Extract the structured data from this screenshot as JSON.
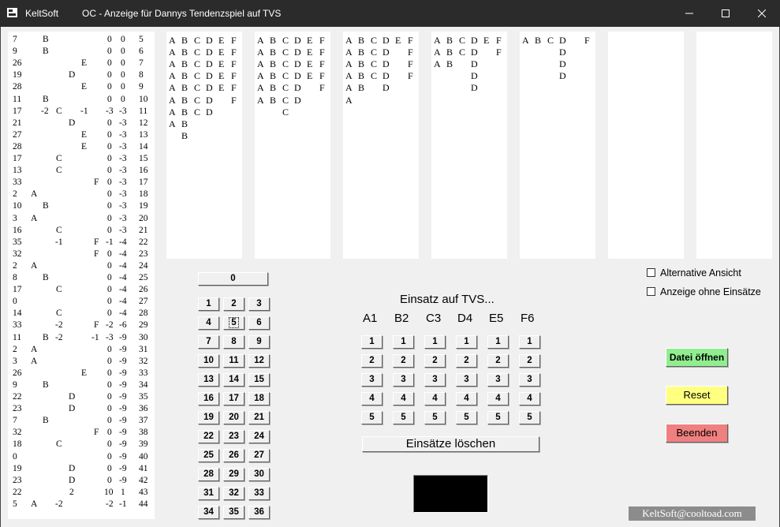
{
  "window": {
    "app_name": "KeltSoft",
    "title": "OC - Anzeige für Dannys Tendenzspiel auf TVS",
    "controls": [
      "minimize-icon",
      "maximize-icon",
      "close-icon"
    ]
  },
  "left_list": [
    [
      "7",
      "",
      "B",
      "",
      "",
      "",
      "",
      "",
      "",
      "0",
      "0",
      "5"
    ],
    [
      "9",
      "",
      "B",
      "",
      "",
      "",
      "",
      "",
      "",
      "0",
      "0",
      "6"
    ],
    [
      "26",
      "",
      "",
      "",
      "",
      "",
      "E",
      "",
      "",
      "0",
      "0",
      "7"
    ],
    [
      "19",
      "",
      "",
      "",
      "",
      "D",
      "",
      "",
      "",
      "0",
      "0",
      "8"
    ],
    [
      "28",
      "",
      "",
      "",
      "",
      "",
      "E",
      "",
      "",
      "0",
      "0",
      "9"
    ],
    [
      "11",
      "",
      "B",
      "",
      "",
      "",
      "",
      "",
      "",
      "0",
      "0",
      "10"
    ],
    [
      "17",
      "",
      "-2",
      "C",
      "-1",
      "",
      "",
      "",
      "",
      "-3",
      "-3",
      "11"
    ],
    [
      "21",
      "",
      "",
      "",
      "",
      "D",
      "",
      "",
      "",
      "0",
      "-3",
      "12"
    ],
    [
      "27",
      "",
      "",
      "",
      "",
      "",
      "E",
      "",
      "",
      "0",
      "-3",
      "13"
    ],
    [
      "28",
      "",
      "",
      "",
      "",
      "",
      "E",
      "",
      "",
      "0",
      "-3",
      "14"
    ],
    [
      "17",
      "",
      "",
      "C",
      "",
      "",
      "",
      "",
      "",
      "0",
      "-3",
      "15"
    ],
    [
      "13",
      "",
      "",
      "C",
      "",
      "",
      "",
      "",
      "",
      "0",
      "-3",
      "16"
    ],
    [
      "33",
      "",
      "",
      "",
      "",
      "",
      "",
      "",
      "F",
      "0",
      "-3",
      "17"
    ],
    [
      "2",
      "A",
      "",
      "",
      "",
      "",
      "",
      "",
      "",
      "0",
      "-3",
      "18"
    ],
    [
      "10",
      "",
      "B",
      "",
      "",
      "",
      "",
      "",
      "",
      "0",
      "-3",
      "19"
    ],
    [
      "3",
      "A",
      "",
      "",
      "",
      "",
      "",
      "",
      "",
      "0",
      "-3",
      "20"
    ],
    [
      "16",
      "",
      "",
      "C",
      "",
      "",
      "",
      "",
      "",
      "0",
      "-3",
      "21"
    ],
    [
      "35",
      "",
      "",
      "-1",
      "",
      "",
      "",
      "",
      "F",
      "-1",
      "-4",
      "22"
    ],
    [
      "32",
      "",
      "",
      "",
      "",
      "",
      "",
      "",
      "F",
      "0",
      "-4",
      "23"
    ],
    [
      "2",
      "A",
      "",
      "",
      "",
      "",
      "",
      "",
      "",
      "0",
      "-4",
      "24"
    ],
    [
      "8",
      "",
      "B",
      "",
      "",
      "",
      "",
      "",
      "",
      "0",
      "-4",
      "25"
    ],
    [
      "17",
      "",
      "",
      "C",
      "",
      "",
      "",
      "",
      "",
      "0",
      "-4",
      "26"
    ],
    [
      "0",
      "",
      "",
      "",
      "",
      "",
      "",
      "",
      "",
      "0",
      "-4",
      "27"
    ],
    [
      "14",
      "",
      "",
      "C",
      "",
      "",
      "",
      "",
      "",
      "0",
      "-4",
      "28"
    ],
    [
      "33",
      "",
      "",
      "-2",
      "",
      "",
      "",
      "",
      "F",
      "-2",
      "-6",
      "29"
    ],
    [
      "11",
      "",
      "B",
      "-2",
      "",
      "",
      "",
      "",
      "-1",
      "-3",
      "-9",
      "30"
    ],
    [
      "2",
      "A",
      "",
      "",
      "",
      "",
      "",
      "",
      "",
      "0",
      "-9",
      "31"
    ],
    [
      "3",
      "A",
      "",
      "",
      "",
      "",
      "",
      "",
      "",
      "0",
      "-9",
      "32"
    ],
    [
      "26",
      "",
      "",
      "",
      "",
      "",
      "E",
      "",
      "",
      "0",
      "-9",
      "33"
    ],
    [
      "9",
      "",
      "B",
      "",
      "",
      "",
      "",
      "",
      "",
      "0",
      "-9",
      "34"
    ],
    [
      "22",
      "",
      "",
      "",
      "",
      "D",
      "",
      "",
      "",
      "0",
      "-9",
      "35"
    ],
    [
      "23",
      "",
      "",
      "",
      "",
      "D",
      "",
      "",
      "",
      "0",
      "-9",
      "36"
    ],
    [
      "7",
      "",
      "B",
      "",
      "",
      "",
      "",
      "",
      "",
      "0",
      "-9",
      "37"
    ],
    [
      "32",
      "",
      "",
      "",
      "",
      "",
      "",
      "",
      "F",
      "0",
      "-9",
      "38"
    ],
    [
      "18",
      "",
      "",
      "C",
      "",
      "",
      "",
      "",
      "",
      "0",
      "-9",
      "39"
    ],
    [
      "0",
      "",
      "",
      "",
      "",
      "",
      "",
      "",
      "",
      "0",
      "-9",
      "40"
    ],
    [
      "19",
      "",
      "",
      "",
      "",
      "D",
      "",
      "",
      "",
      "0",
      "-9",
      "41"
    ],
    [
      "23",
      "",
      "",
      "",
      "",
      "D",
      "",
      "",
      "",
      "0",
      "-9",
      "42"
    ],
    [
      "22",
      "",
      "",
      "",
      "",
      "2",
      "",
      "",
      "",
      "10",
      "1",
      "43"
    ],
    [
      "5",
      "A",
      "",
      "-2",
      "",
      "",
      "",
      "",
      "",
      "-2",
      "-1",
      "44"
    ]
  ],
  "panels": [
    [
      "ABCDEF",
      "ABCDEF",
      "ABCDEF",
      "ABCDEF",
      "ABCDEF",
      "ABCD F",
      "ABCD",
      "AB",
      " B"
    ],
    [
      "ABCDEF",
      "ABCDEF",
      "ABCDEF",
      "ABCDEF",
      "ABCD F",
      "ABCD",
      "  C"
    ],
    [
      "ABCDEF",
      "ABCD F",
      "ABCD F",
      "ABCD F",
      "AB D",
      "A"
    ],
    [
      "ABCDEF",
      "ABCD F",
      "AB D",
      "   D",
      "   D"
    ],
    [
      "ABCD F",
      "   D",
      "   D",
      "   D"
    ],
    [],
    []
  ],
  "number_pad": {
    "zero": "0",
    "selected": "5",
    "rows": [
      [
        "1",
        "2",
        "3"
      ],
      [
        "4",
        "5",
        "6"
      ],
      [
        "7",
        "8",
        "9"
      ],
      [
        "10",
        "11",
        "12"
      ],
      [
        "13",
        "14",
        "15"
      ],
      [
        "16",
        "17",
        "18"
      ],
      [
        "19",
        "20",
        "21"
      ],
      [
        "22",
        "23",
        "24"
      ],
      [
        "25",
        "26",
        "27"
      ],
      [
        "28",
        "29",
        "30"
      ],
      [
        "31",
        "32",
        "33"
      ],
      [
        "34",
        "35",
        "36"
      ]
    ]
  },
  "bets": {
    "title": "Einsatz auf TVS...",
    "columns": [
      "A1",
      "B2",
      "C3",
      "D4",
      "E5",
      "F6"
    ],
    "amounts": [
      "1",
      "2",
      "3",
      "4",
      "5"
    ],
    "clear_label": "Einsätze löschen"
  },
  "options": {
    "alt_view": "Alternative Ansicht",
    "no_bets": "Anzeige ohne Einsätze"
  },
  "actions": {
    "open": {
      "label": "Datei öffnen",
      "color": "#90ee90"
    },
    "reset": {
      "label": "Reset",
      "color": "#ffff80"
    },
    "quit": {
      "label": "Beenden",
      "color": "#f08080"
    }
  },
  "footer": {
    "email": "KeltSoft@cooltoad.com"
  }
}
